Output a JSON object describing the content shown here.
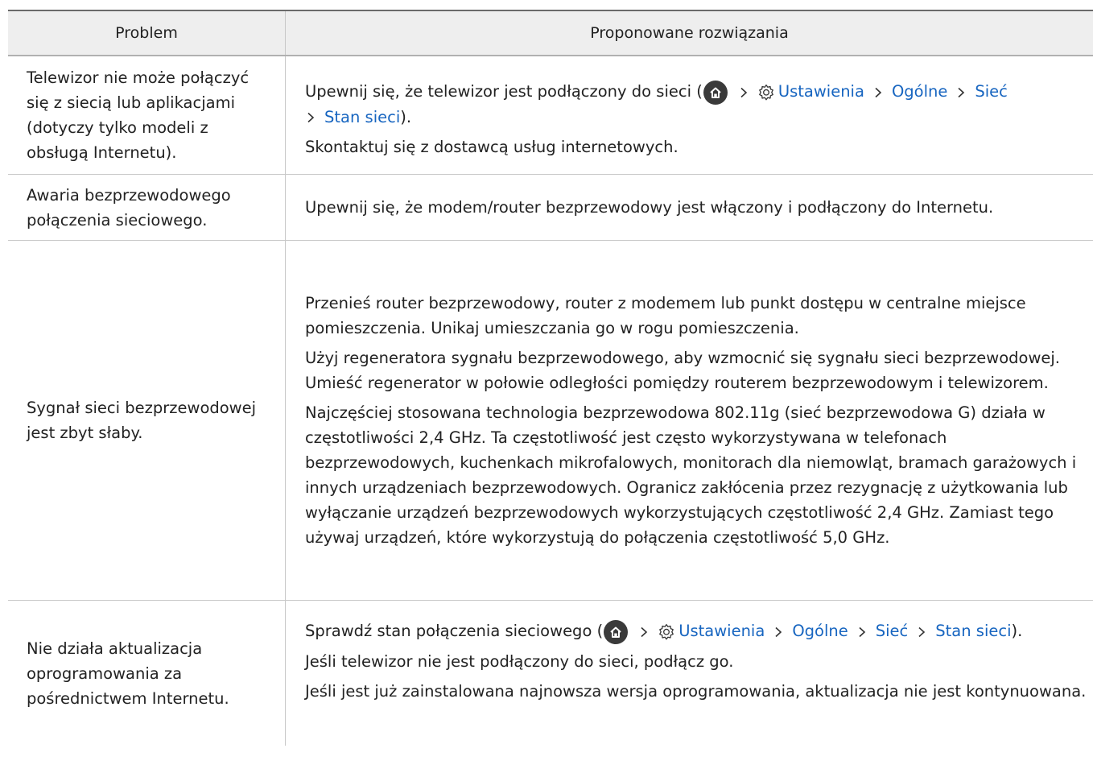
{
  "header": {
    "problem": "Problem",
    "solution": "Proponowane rozwiązania"
  },
  "rows": [
    {
      "problem": "Telewizor nie może połączyć się z siecią lub aplikacjami (dotyczy tylko modeli z obsługą Internetu).",
      "s1_pre": "Upewnij się, że telewizor jest podłączony do sieci (",
      "nav": [
        "Ustawienia",
        "Ogólne",
        "Sieć",
        "Stan sieci"
      ],
      "s1_post": ").",
      "s2": "Skontaktuj się z dostawcą usług internetowych."
    },
    {
      "problem": "Awaria bezprzewodowego połączenia sieciowego.",
      "s1": "Upewnij się, że modem/router bezprzewodowy jest włączony i podłączony do Internetu."
    },
    {
      "problem": "Sygnał sieci bezprzewodowej jest zbyt słaby.",
      "s1": "Przenieś router bezprzewodowy, router z modemem lub punkt dostępu w centralne miejsce pomieszczenia. Unikaj umieszczania go w rogu pomieszczenia.",
      "s2": "Użyj regeneratora sygnału bezprzewodowego, aby wzmocnić się sygnału sieci bezprzewodowej. Umieść regenerator w połowie odległości pomiędzy routerem bezprzewodowym i telewizorem.",
      "s3": "Najczęściej stosowana technologia bezprzewodowa 802.11g (sieć bezprzewodowa G) działa w częstotliwości 2,4 GHz. Ta częstotliwość jest często wykorzystywana w telefonach bezprzewodowych, kuchenkach mikrofalowych, monitorach dla niemowląt, bramach garażowych i innych urządzeniach bezprzewodowych. Ogranicz zakłócenia przez rezygnację z użytkowania lub wyłączanie urządzeń bezprzewodowych wykorzystujących częstotliwość 2,4 GHz. Zamiast tego używaj urządzeń, które wykorzystują do połączenia częstotliwość 5,0 GHz."
    },
    {
      "problem": "Nie działa aktualizacja oprogramowania za pośrednictwem Internetu.",
      "s1_pre": "Sprawdź stan połączenia sieciowego (",
      "nav": [
        "Ustawienia",
        "Ogólne",
        "Sieć",
        "Stan sieci"
      ],
      "s1_post": ").",
      "s2": "Jeśli telewizor nie jest podłączony do sieci, podłącz go.",
      "s3": "Jeśli jest już zainstalowana najnowsza wersja oprogramowania, aktualizacja nie jest kontynuowana."
    }
  ],
  "colors": {
    "link": "#1765c0",
    "header_bg": "#eeeeee",
    "text": "#222222"
  }
}
